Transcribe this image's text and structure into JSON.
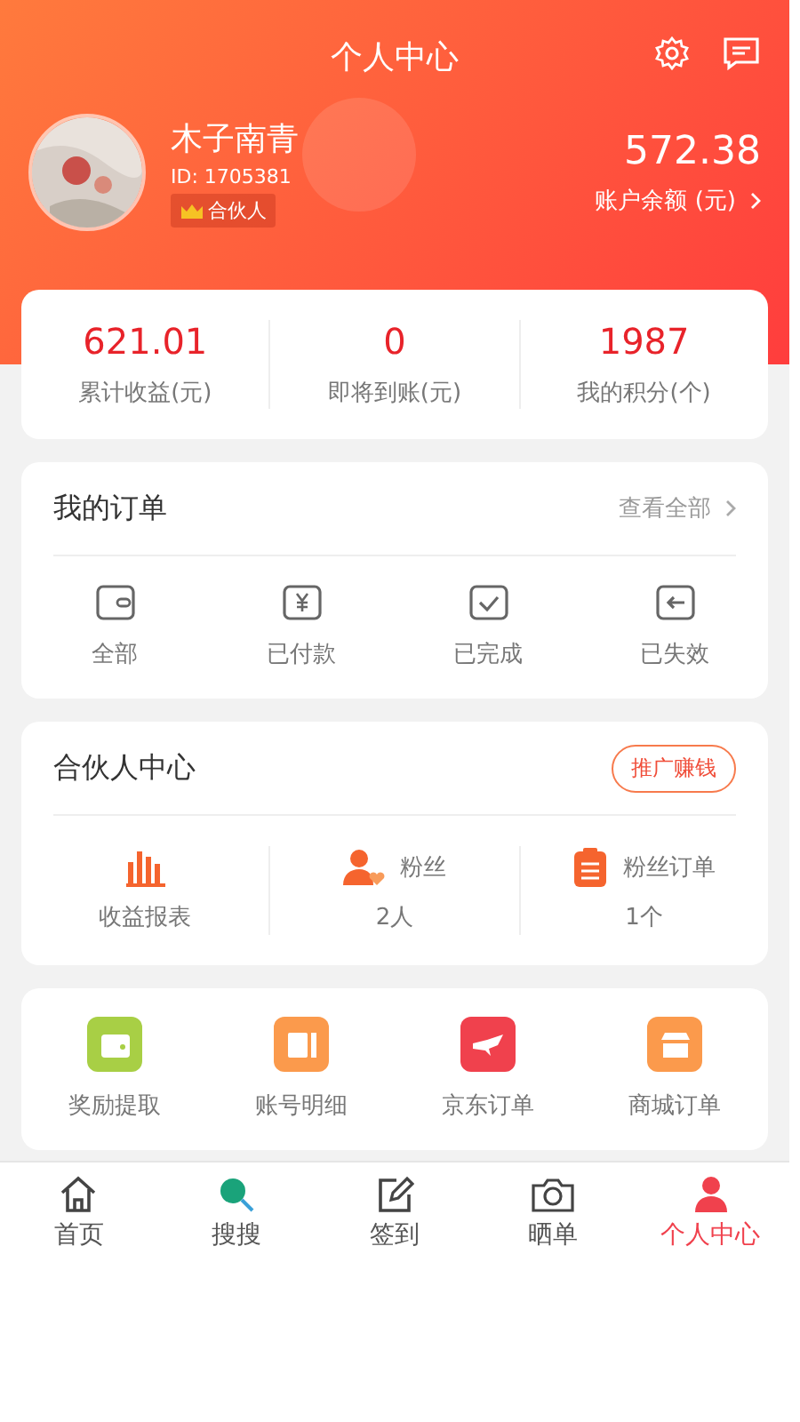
{
  "header": {
    "title": "个人中心"
  },
  "profile": {
    "name": "木子南青",
    "id": "ID: 1705381",
    "badge": "合伙人",
    "balance": "572.38",
    "balance_label": "账户余额 (元)"
  },
  "stats": [
    {
      "value": "621.01",
      "label": "累计收益(元)"
    },
    {
      "value": "0",
      "label": "即将到账(元)"
    },
    {
      "value": "1987",
      "label": "我的积分(个)"
    }
  ],
  "orders": {
    "title": "我的订单",
    "more": "查看全部",
    "items": [
      {
        "kind": "all",
        "label": "全部"
      },
      {
        "kind": "paid",
        "label": "已付款"
      },
      {
        "kind": "done",
        "label": "已完成"
      },
      {
        "kind": "expired",
        "label": "已失效"
      }
    ]
  },
  "partner": {
    "title": "合伙人中心",
    "action": "推广赚钱",
    "report": "收益报表",
    "fans_label": "粉丝",
    "fans": "2人",
    "fan_orders_label": "粉丝订单",
    "fan_orders": "1个"
  },
  "services": [
    {
      "kind": "wallet",
      "label": "奖励提取",
      "color": "#a8cf45"
    },
    {
      "kind": "ledger",
      "label": "账号明细",
      "color": "#fb9a4c"
    },
    {
      "kind": "plane",
      "label": "京东订单",
      "color": "#f0414d"
    },
    {
      "kind": "shop",
      "label": "商城订单",
      "color": "#fb9a4c"
    }
  ],
  "tabs": [
    {
      "kind": "home",
      "label": "首页",
      "selected": false
    },
    {
      "kind": "search",
      "label": "搜搜",
      "selected": false
    },
    {
      "kind": "sign",
      "label": "签到",
      "selected": false
    },
    {
      "kind": "camera",
      "label": "晒单",
      "selected": false
    },
    {
      "kind": "me",
      "label": "个人中心",
      "selected": true
    }
  ]
}
